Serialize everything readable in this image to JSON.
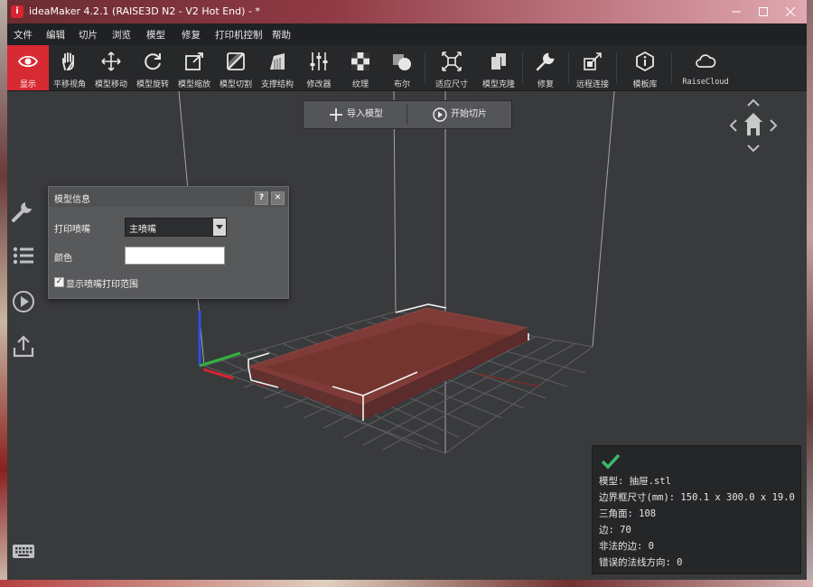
{
  "window": {
    "title": "ideaMaker 4.2.1 (RAISE3D N2 - V2 Hot End) - *",
    "app_logo": "i",
    "controls": [
      "minimize-icon",
      "maximize-icon",
      "close-icon"
    ]
  },
  "menu": [
    {
      "label": "文件"
    },
    {
      "label": "编辑"
    },
    {
      "label": "切片"
    },
    {
      "label": "浏览"
    },
    {
      "label": "模型"
    },
    {
      "label": "修复"
    },
    {
      "label": "打印机控制"
    },
    {
      "label": "帮助"
    }
  ],
  "toolbar": [
    {
      "label": "显示",
      "icon": "eye-icon",
      "active": true
    },
    {
      "label": "平移视角",
      "icon": "hand-icon"
    },
    {
      "label": "模型移动",
      "icon": "move-icon"
    },
    {
      "label": "模型旋转",
      "icon": "rotate-icon"
    },
    {
      "label": "模型缩放",
      "icon": "scale-icon"
    },
    {
      "label": "模型切割",
      "icon": "cut-icon"
    },
    {
      "label": "支撑结构",
      "icon": "support-icon"
    },
    {
      "label": "修改器",
      "icon": "modifier-icon"
    },
    {
      "label": "纹理",
      "icon": "texture-icon"
    },
    {
      "label": "布尔",
      "icon": "boolean-icon"
    },
    {
      "label": "适应尺寸",
      "icon": "fit-size-icon"
    },
    {
      "label": "模型克隆",
      "icon": "clone-icon"
    },
    {
      "label": "修复",
      "icon": "repair-icon"
    },
    {
      "label": "远程连接",
      "icon": "remote-icon"
    },
    {
      "label": "模板库",
      "icon": "template-icon"
    },
    {
      "label": "RaiseCloud",
      "icon": "cloud-icon"
    }
  ],
  "center_actions": {
    "import_label": "导入模型",
    "slice_label": "开始切片"
  },
  "model_info_panel": {
    "title": "模型信息",
    "help": "?",
    "close": "✕",
    "nozzle_label": "打印喷嘴",
    "nozzle_value": "主喷嘴",
    "color_label": "颜色",
    "color_value": "#ffffff",
    "show_range_label": "显示喷嘴打印范围",
    "show_range_checked": true
  },
  "model_stats": {
    "status_icon": "checkmark-icon",
    "lines": [
      "模型: 抽屉.stl",
      "边界框尺寸(mm): 150.1 x 300.0 x 19.0",
      "三角面: 108",
      "边: 70",
      "非法的边: 0",
      "错误的法线方向: 0"
    ]
  },
  "colors": {
    "accent": "#d72a33",
    "model": "#7a3b36",
    "axis_x": "#d8242f",
    "axis_y": "#2fb43a",
    "axis_z": "#2f4fdc",
    "success": "#3fb868"
  }
}
